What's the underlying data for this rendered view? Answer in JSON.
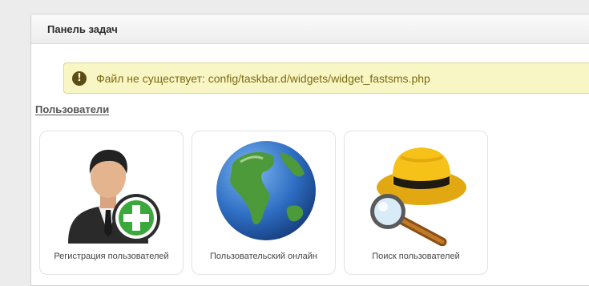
{
  "panel": {
    "title": "Панель задач"
  },
  "alert": {
    "icon": "exclamation-icon",
    "message": "Файл не существует: config/taskbar.d/widgets/widget_fastsms.php"
  },
  "section": {
    "title": "Пользователи"
  },
  "tiles": [
    {
      "icon": "user-add-icon",
      "label": "Регистрация пользователей"
    },
    {
      "icon": "globe-icon",
      "label": "Пользовательский онлайн"
    },
    {
      "icon": "search-user-icon",
      "label": "Поиск пользователей"
    }
  ],
  "colors": {
    "alert_bg": "#f9f6c5",
    "alert_text": "#7a6a12",
    "tile_border": "#e2e2e2"
  }
}
